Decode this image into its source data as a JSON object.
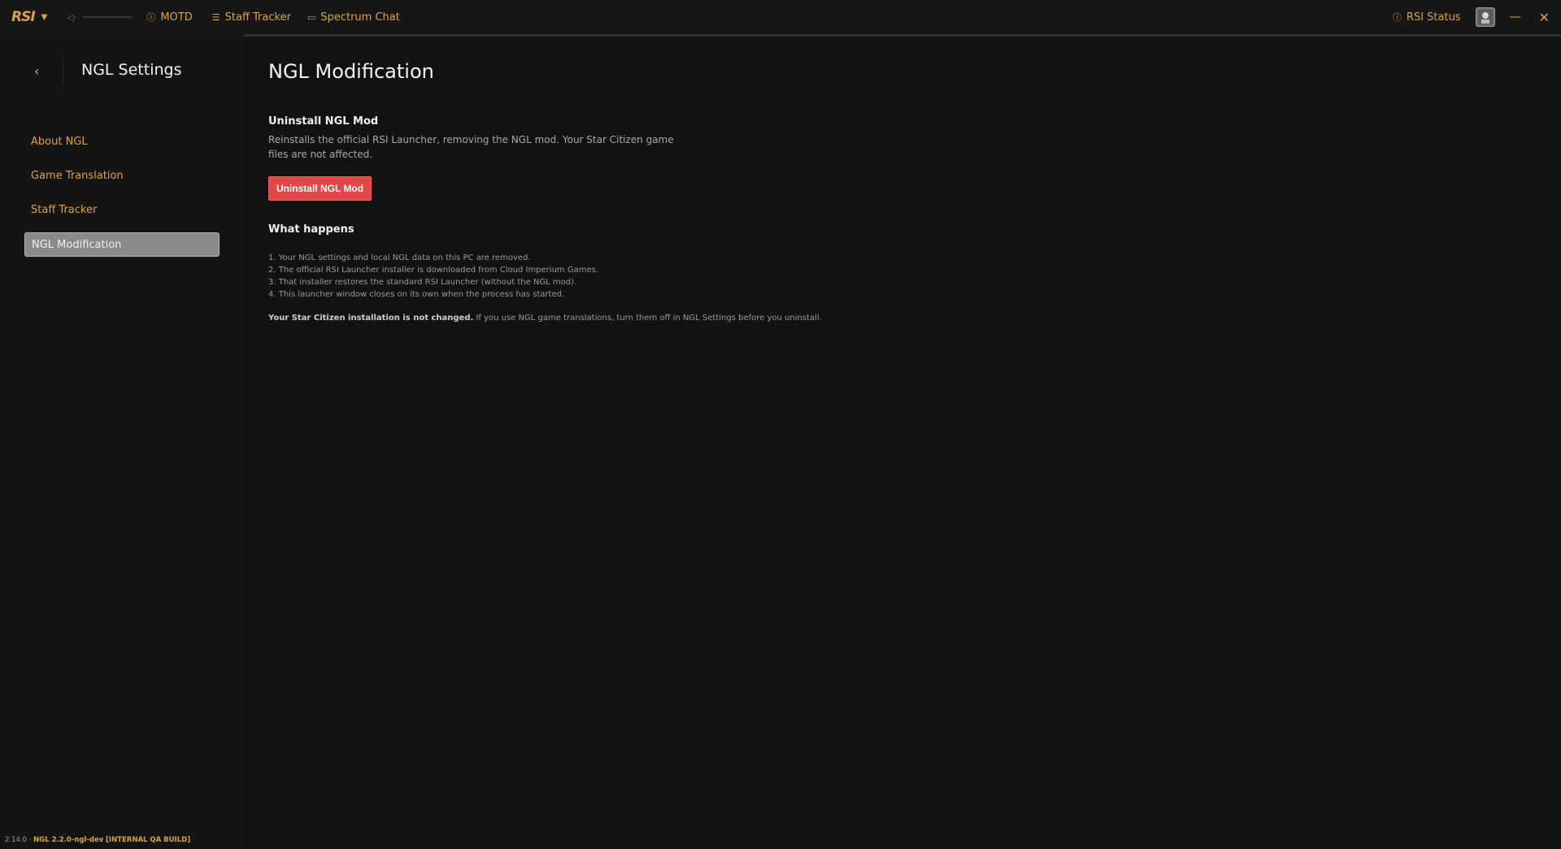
{
  "topbar": {
    "logo": "RSI",
    "nav": [
      {
        "icon": "info-circle-icon",
        "label": "MOTD"
      },
      {
        "icon": "list-icon",
        "label": "Staff Tracker"
      },
      {
        "icon": "chat-icon",
        "label": "Spectrum Chat"
      }
    ],
    "status_label": "RSI Status"
  },
  "sidebar": {
    "title": "NGL Settings",
    "items": [
      {
        "label": "About NGL"
      },
      {
        "label": "Game Translation"
      },
      {
        "label": "Staff Tracker"
      },
      {
        "label": "NGL Modification",
        "active": true
      }
    ],
    "footer": {
      "version": "2.14.0 ·",
      "ngl_version": "NGL 2.2.0-ngl-dev",
      "qa": "[INTERNAL QA BUILD]"
    }
  },
  "main": {
    "title": "NGL Modification",
    "uninstall": {
      "heading": "Uninstall NGL Mod",
      "description": "Reinstalls the official RSI Launcher, removing the NGL mod. Your Star Citizen game files are not affected.",
      "button_label": "Uninstall NGL Mod"
    },
    "what_happens": {
      "heading": "What happens",
      "steps": [
        "1. Your NGL settings and local NGL data on this PC are removed.",
        "2. The official RSI Launcher installer is downloaded from Cloud Imperium Games.",
        "3. That installer restores the standard RSI Launcher (without the NGL mod).",
        "4. This launcher window closes on its own when the process has started."
      ],
      "note_bold": "Your Star Citizen installation is not changed.",
      "note_rest": " If you use NGL game translations, turn them off in NGL Settings before you uninstall."
    }
  },
  "colors": {
    "accent": "#d9a445",
    "danger": "#e04848",
    "background": "#121212"
  }
}
